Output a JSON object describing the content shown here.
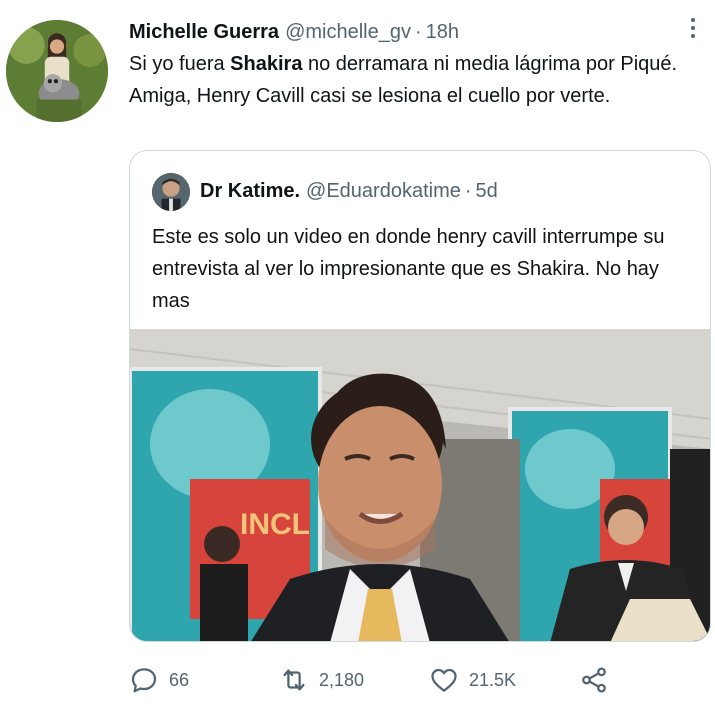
{
  "tweet": {
    "author_name": "Michelle Guerra",
    "author_handle": "@michelle_gv",
    "separator": "·",
    "time": "18h",
    "text_before": "Si yo fuera ",
    "text_bold": "Shakira",
    "text_after": " no derramara ni media lágrima por Piqué. Amiga, Henry Cavill casi se lesiona el cuello por verte."
  },
  "quoted": {
    "author_name": "Dr Katime.",
    "author_handle": "@Eduardokatime",
    "separator": "·",
    "time": "5d",
    "text": "Este es solo un video en donde henry cavill interrumpe su entrevista al ver lo impresionante que es Shakira. No hay mas"
  },
  "actions": {
    "replies": "66",
    "retweets": "2,180",
    "likes": "21.5K"
  },
  "icons": {
    "reply": "reply-icon",
    "retweet": "retweet-icon",
    "like": "heart-icon",
    "share": "share-icon",
    "more": "more-icon"
  },
  "colors": {
    "text": "#0f1419",
    "muted": "#536471",
    "border": "#cfd9de"
  }
}
